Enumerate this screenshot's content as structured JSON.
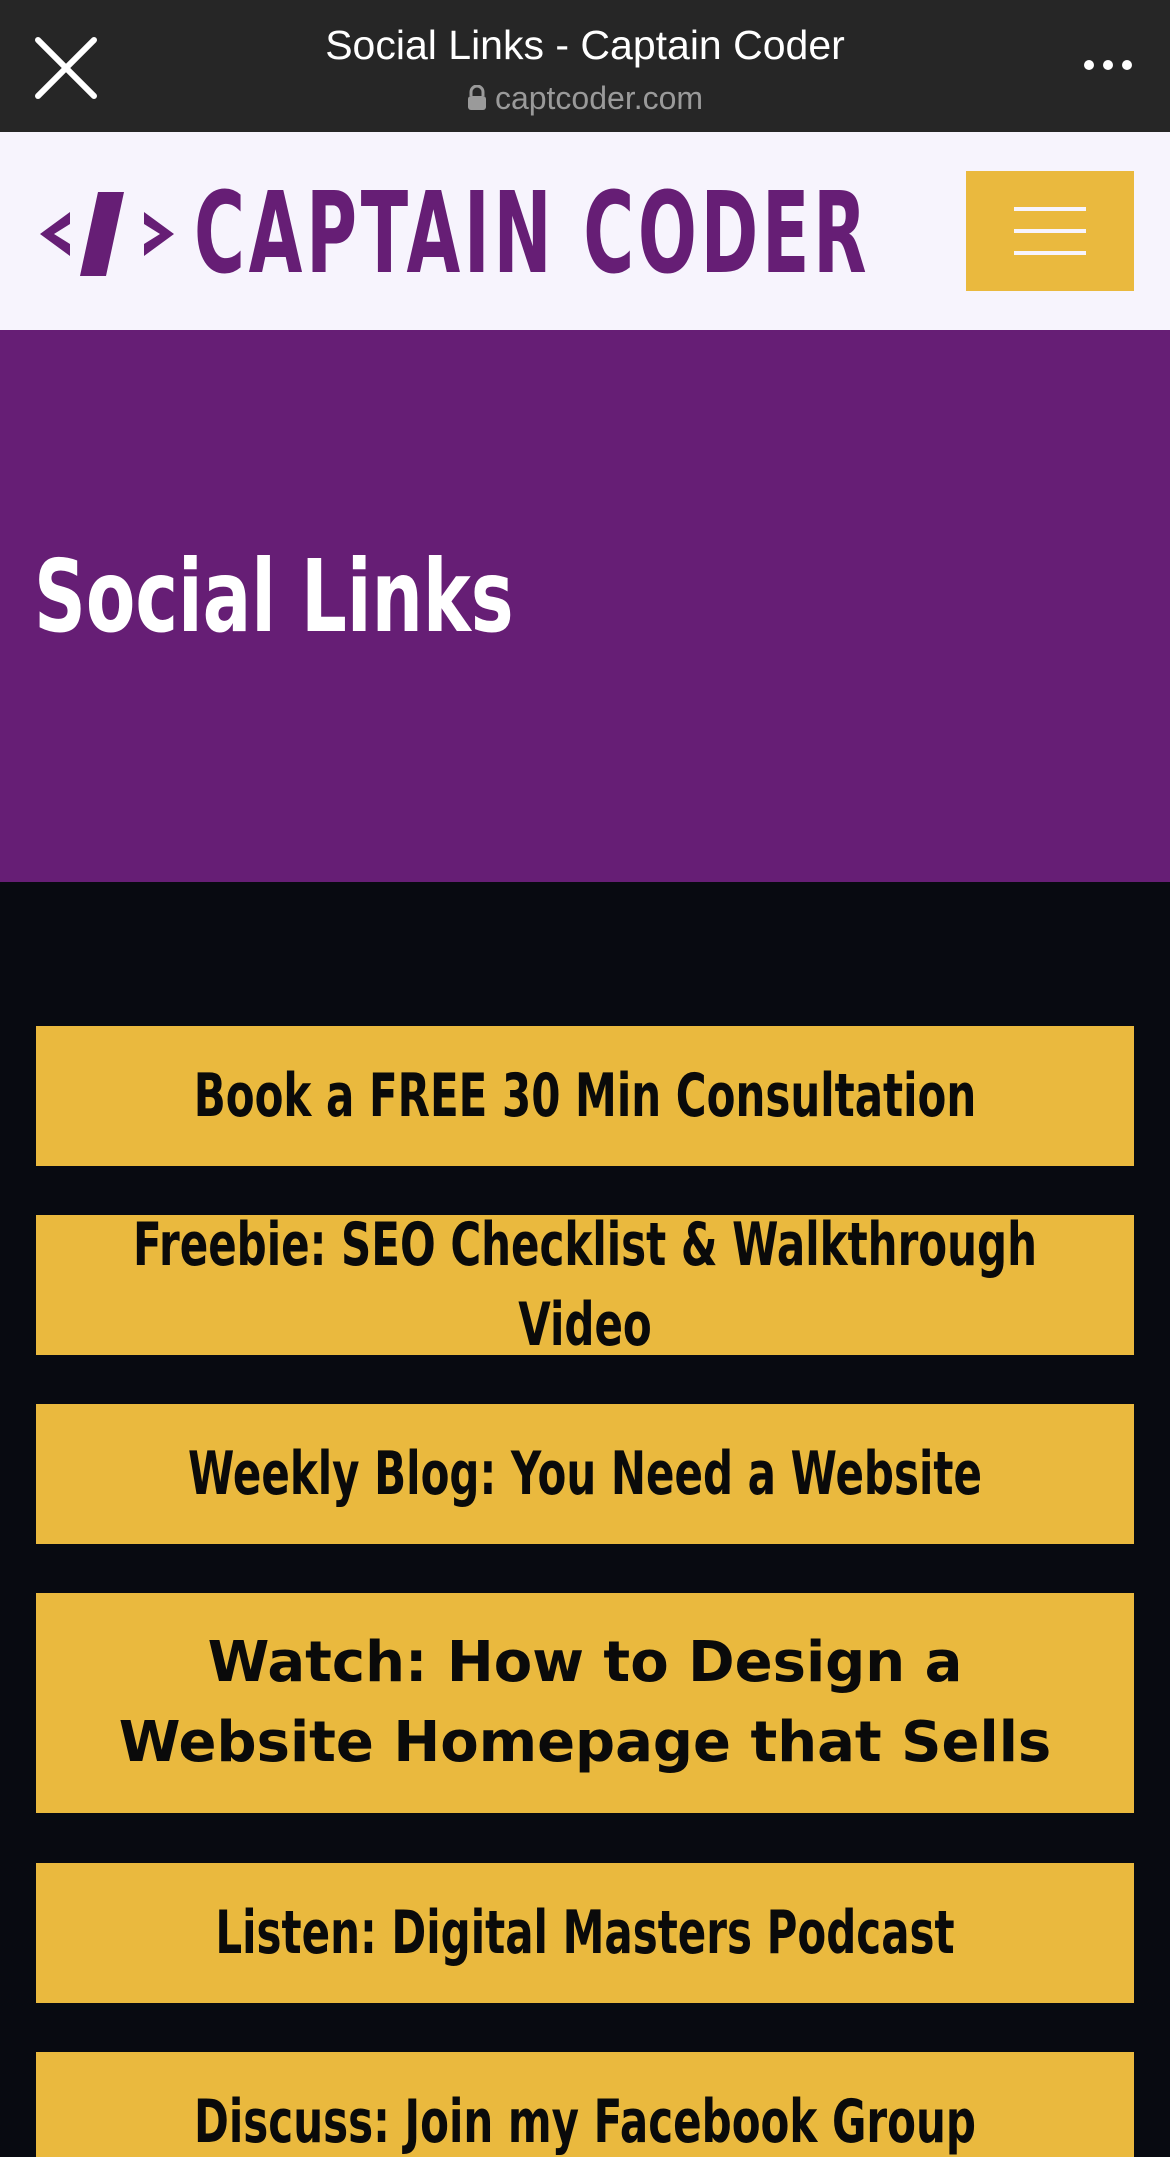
{
  "browser": {
    "title": "Social Links - Captain Coder",
    "url": "captcoder.com",
    "close_icon": "close-icon",
    "lock_icon": "lock-icon",
    "more_icon": "more-options-icon"
  },
  "header": {
    "logo_mark": "</>",
    "logo_text": "CAPTAIN CODER",
    "menu_icon": "hamburger-menu-icon"
  },
  "hero": {
    "title": "Social Links"
  },
  "links": [
    {
      "label": "Book a FREE 30 Min Consultation"
    },
    {
      "label": "Freebie: SEO Checklist & Walkthrough Video"
    },
    {
      "label": "Weekly Blog: You Need a Website"
    },
    {
      "label": "Watch: How to Design a Website Homepage that Sells"
    },
    {
      "label": "Listen: Digital Masters Podcast"
    },
    {
      "label": "Discuss: Join my Facebook Group"
    }
  ],
  "colors": {
    "chrome_bg": "#262626",
    "header_bg": "#f7f4fd",
    "brand_purple": "#661e75",
    "accent_yellow": "#eab93e",
    "page_bg": "#080a11"
  }
}
